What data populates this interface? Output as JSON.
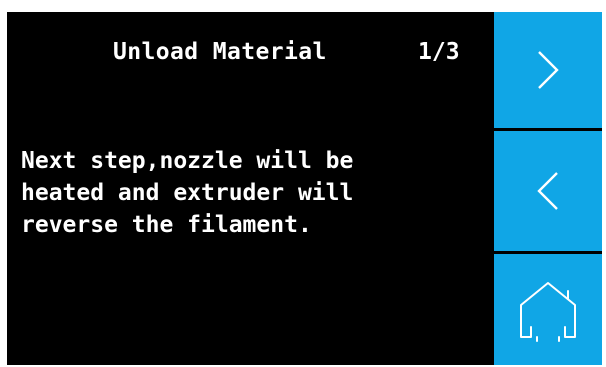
{
  "screen": {
    "title": "Unload Material",
    "page_indicator": "1/3",
    "message_lines": [
      "Next step,nozzle will be",
      "heated and extruder will",
      "reverse the filament."
    ]
  },
  "buttons": {
    "next": {
      "icon": "chevron-right-icon"
    },
    "back": {
      "icon": "chevron-left-icon"
    },
    "home": {
      "icon": "home-icon"
    }
  },
  "colors": {
    "background": "#000000",
    "button": "#10a6e6",
    "text": "#ffffff"
  }
}
